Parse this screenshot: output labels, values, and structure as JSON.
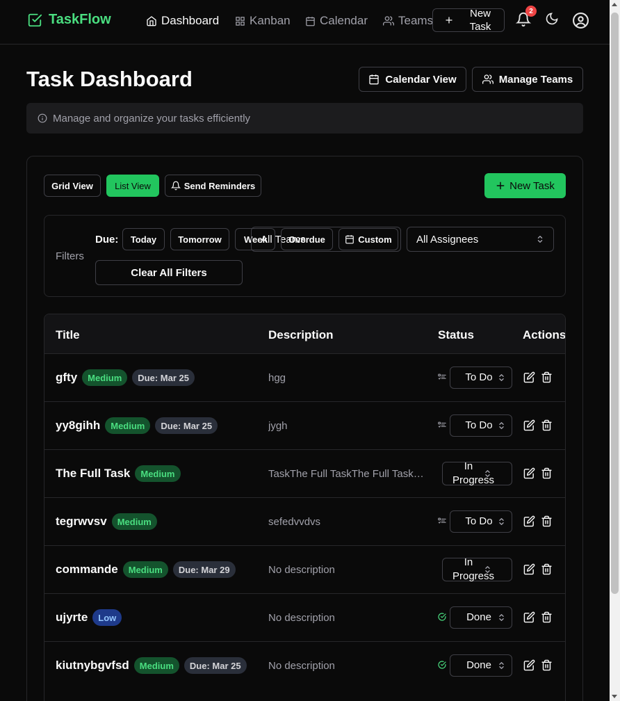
{
  "nav": {
    "brand": "TaskFlow",
    "items": [
      {
        "label": "Dashboard",
        "icon": "home-icon",
        "active": true
      },
      {
        "label": "Kanban",
        "icon": "grid-icon",
        "active": false
      },
      {
        "label": "Calendar",
        "icon": "calendar-icon",
        "active": false
      },
      {
        "label": "Teams",
        "icon": "users-icon",
        "active": false
      }
    ],
    "new_task": "New Task",
    "notification_count": "2"
  },
  "header": {
    "title": "Task Dashboard",
    "calendar_view": "Calendar View",
    "manage_teams": "Manage Teams",
    "info": "Manage and organize your tasks efficiently"
  },
  "toolbar": {
    "grid_view": "Grid View",
    "list_view": "List View",
    "send_reminders": "Send Reminders",
    "new_task": "New Task"
  },
  "filters": {
    "label": "Filters",
    "due_label": "Due:",
    "today": "Today",
    "tomorrow": "Tomorrow",
    "week": "Week",
    "all_teams": "All Teams",
    "overdue": "Overdue",
    "custom": "Custom",
    "assignees": "All Assignees",
    "clear": "Clear All Filters"
  },
  "table": {
    "columns": [
      "Title",
      "Description",
      "Status",
      "Actions"
    ],
    "rows": [
      {
        "title": "gfty",
        "priority": "Medium",
        "due": "Due: Mar 25",
        "description": "hgg",
        "status": "To Do"
      },
      {
        "title": "yy8gihh",
        "priority": "Medium",
        "due": "Due: Mar 25",
        "description": "jygh",
        "status": "To Do"
      },
      {
        "title": "The Full Task",
        "priority": "Medium",
        "due": "",
        "description": "TaskThe Full TaskThe Full TaskThe Full Task",
        "status": "In Progress"
      },
      {
        "title": "tegrwvsv",
        "priority": "Medium",
        "due": "",
        "description": "sefedvvdvs",
        "status": "To Do"
      },
      {
        "title": "commande",
        "priority": "Medium",
        "due": "Due: Mar 29",
        "description": "No description",
        "status": "In Progress"
      },
      {
        "title": "ujyrte",
        "priority": "Low",
        "due": "",
        "description": "No description",
        "status": "Done"
      },
      {
        "title": "kiutnybgvfsd",
        "priority": "Medium",
        "due": "Due: Mar 25",
        "description": "No description",
        "status": "Done"
      }
    ]
  },
  "colors": {
    "accent": "#22c55e",
    "background": "#0a0a0a",
    "medium_badge": "#14532d",
    "low_badge": "#1e3a8a",
    "notification": "#ef4444"
  }
}
